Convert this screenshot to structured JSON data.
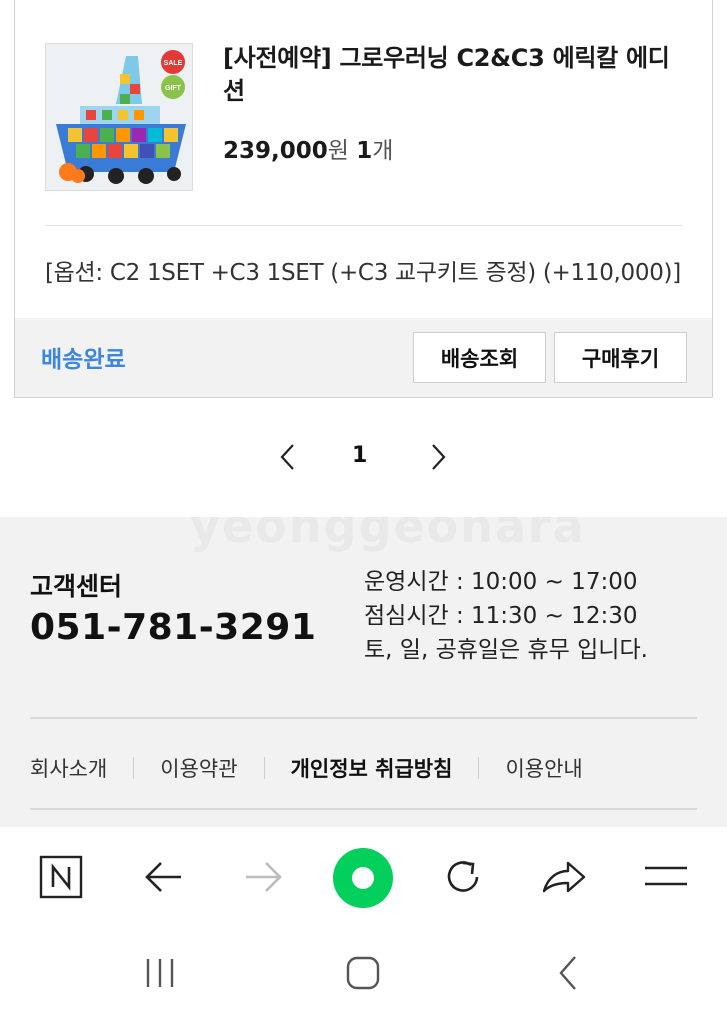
{
  "order": {
    "product_title": "[사전예약] 그로우러닝 C2&C3 에릭칼 에디션",
    "thumb_badge_sale": "SALE",
    "thumb_badge_gift": "GIFT",
    "price": "239,000",
    "price_unit": "원",
    "qty": "1",
    "qty_unit": "개",
    "option": "[옵션: C2 1SET +C3 1SET (+C3 교구키트 증정) (+110,000)]",
    "status": "배송완료",
    "track_button": "배송조회",
    "review_button": "구매후기"
  },
  "pagination": {
    "current_page": "1",
    "prev_icon": "chevron-left-icon",
    "next_icon": "chevron-right-icon"
  },
  "footer": {
    "watermark": "yeonggeonara",
    "cs_title": "고객센터",
    "cs_phone": "051-781-3291",
    "hours_line1": "운영시간 : 10:00 ~ 17:00",
    "hours_line2": "점심시간 : 11:30 ~ 12:30",
    "hours_line3": "토, 일, 공휴일은 휴무 입니다.",
    "links": [
      "회사소개",
      "이용약관",
      "개인정보 취급방침",
      "이용안내"
    ]
  },
  "browser_toolbar": {
    "icons": [
      "naver-home-icon",
      "back-arrow-icon",
      "forward-arrow-icon",
      "green-dot-icon",
      "refresh-icon",
      "share-icon",
      "menu-icon"
    ],
    "brand_color": "#03cf5d"
  },
  "system_nav": {
    "icons": [
      "recent-apps-icon",
      "home-icon",
      "back-icon"
    ]
  },
  "colors": {
    "status_blue": "#3d86e0",
    "footer_bg": "#f2f2f2"
  }
}
